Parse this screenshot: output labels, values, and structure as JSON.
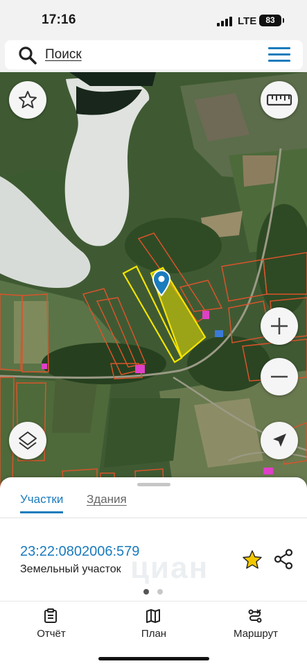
{
  "status_bar": {
    "time": "17:16",
    "network": "LTE",
    "battery": "83",
    "icons": [
      "signal-icon",
      "battery-icon"
    ]
  },
  "search": {
    "label": "Поиск",
    "icons": [
      "search-icon",
      "menu-icon"
    ]
  },
  "map": {
    "selected_parcel": "23:22:0802006:579",
    "buttons": [
      "favorites-star-icon",
      "ruler-icon",
      "zoom-in-icon",
      "zoom-out-icon",
      "layers-icon",
      "location-arrow-icon"
    ],
    "colors": {
      "parcel_outline": "#d9542c",
      "selected_outline": "#f5e400",
      "selected_fill": "#e8e000",
      "marker": "#1a7bbd"
    }
  },
  "sheet": {
    "tabs": [
      {
        "label": "Участки",
        "active": true
      },
      {
        "label": "Здания",
        "active": false
      }
    ],
    "parcel": {
      "cadastral_number": "23:22:0802006:579",
      "type": "Земельный участок"
    },
    "watermark": "циан",
    "pager": {
      "count": 2,
      "active": 0
    },
    "icons": [
      "favorite-star-icon",
      "share-icon"
    ]
  },
  "bottom_nav": [
    {
      "label": "Отчёт",
      "icon": "report-icon"
    },
    {
      "label": "План",
      "icon": "map-plan-icon"
    },
    {
      "label": "Маршрут",
      "icon": "route-icon"
    }
  ],
  "colors": {
    "accent": "#1a7bbd",
    "star": "#f2c700"
  }
}
